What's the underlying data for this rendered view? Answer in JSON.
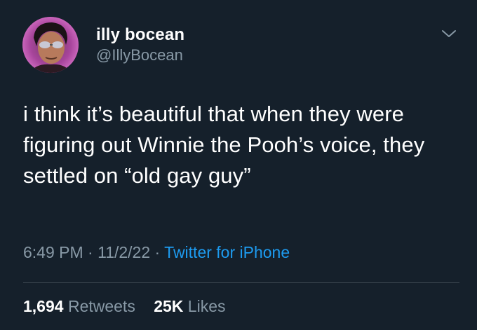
{
  "colors": {
    "background": "#15202b",
    "primary_text": "#ffffff",
    "secondary_text": "#8899a6",
    "link": "#1d9bf0",
    "divider": "#38444d"
  },
  "author": {
    "name": "illy bocean",
    "handle": "@IllyBocean",
    "avatar_icon": "profile-photo-with-sunglasses"
  },
  "menu_icon": "chevron-down-icon",
  "tweet": {
    "text": "i think it’s beautiful that when they were figuring out Winnie the Pooh’s voice, they settled on “old gay guy”",
    "time": "6:49 PM",
    "separator_1": " · ",
    "date": "11/2/22",
    "separator_2": " · ",
    "source": "Twitter for iPhone"
  },
  "stats": {
    "retweets_count": "1,694",
    "retweets_label": " Retweets",
    "likes_count": "25K",
    "likes_label": " Likes"
  }
}
